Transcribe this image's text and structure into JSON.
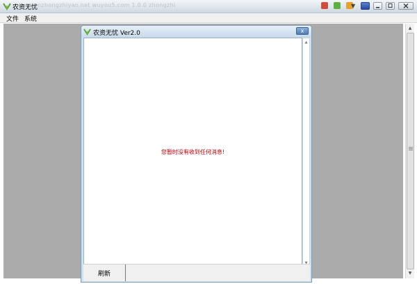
{
  "window": {
    "title": "农资无忧",
    "blurred_url": "nzhongzhiyao.net  wuyou5.com 1.0.0  zhongzhi"
  },
  "menu": [
    "文件",
    "系统"
  ],
  "dialog": {
    "title": "农资无忧 Ver2.0",
    "close_label": "x",
    "message": "您暂时没有收到任何消息!",
    "refresh_label": "刷新"
  },
  "colors": {
    "message": "#b00000",
    "client_background": "#ababab",
    "dialog_frame": "#cfe0ef"
  }
}
